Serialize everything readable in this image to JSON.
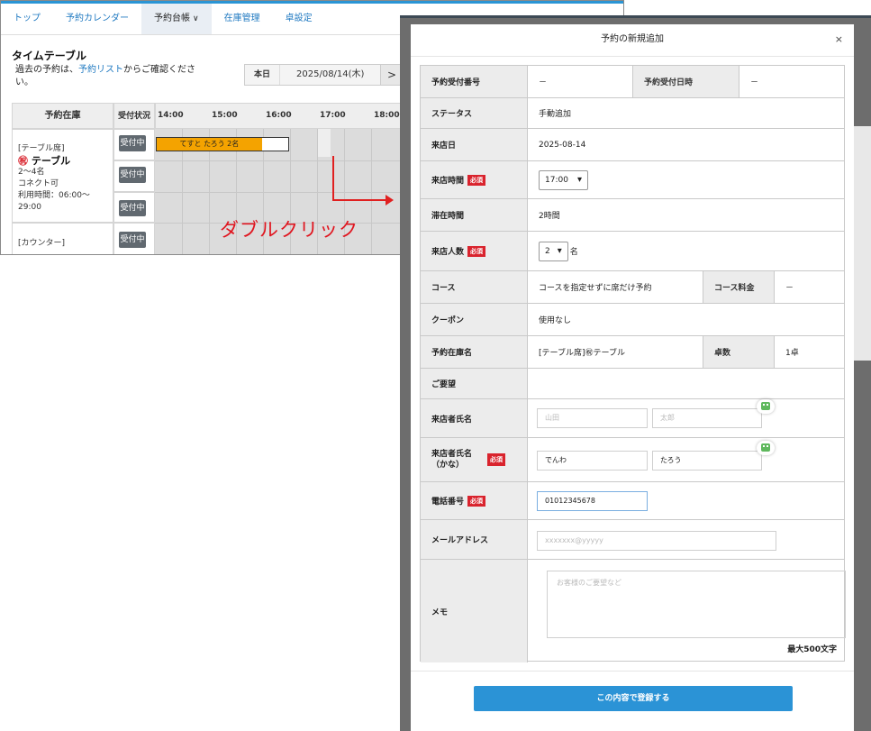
{
  "nav": {
    "items": [
      "トップ",
      "予約カレンダー",
      "予約台帳",
      "在庫管理",
      "卓設定"
    ],
    "active_index": 2
  },
  "timetable": {
    "title": "タイムテーブル",
    "note_prefix": "過去の予約は、",
    "note_link": "予約リスト",
    "note_suffix": "からご確認ください。",
    "today_label": "本日",
    "date": "2025/08/14(木)",
    "next_label": ">",
    "headers": {
      "inventory": "予約在庫",
      "status": "受付状況",
      "times": [
        "14:00",
        "15:00",
        "16:00",
        "17:00",
        "18:00"
      ]
    },
    "rows": [
      {
        "category": "[テーブル席]",
        "name": "テーブル",
        "capacity": "2〜4名",
        "connect": "コネクト可",
        "hours": "利用時間：06:00〜29:00"
      },
      {
        "category": "[カウンター]"
      }
    ],
    "status_label": "受付中",
    "booking": {
      "label": "てすと たろう 2名",
      "fill_fraction": 0.8
    }
  },
  "annotation": {
    "text": "ダブルクリック"
  },
  "modal": {
    "title": "予約の新規追加",
    "close": "×",
    "required": "必須",
    "fields": {
      "reception_no_label": "予約受付番号",
      "reception_no": "－",
      "reception_at_label": "予約受付日時",
      "reception_at": "－",
      "status_label": "ステータス",
      "status": "手動追加",
      "visit_date_label": "来店日",
      "visit_date": "2025-08-14",
      "visit_time_label": "来店時間",
      "visit_time": "17:00",
      "stay_label": "滞在時間",
      "stay": "2時間",
      "people_label": "来店人数",
      "people": "2",
      "people_unit": "名",
      "course_label": "コース",
      "course": "コースを指定せずに席だけ予約",
      "course_fee_label": "コース料金",
      "course_fee": "－",
      "coupon_label": "クーポン",
      "coupon": "使用なし",
      "inventory_label": "予約在庫名",
      "inventory": "[テーブル席]㊗テーブル",
      "tables_label": "卓数",
      "tables": "1卓",
      "request_label": "ご要望",
      "name_label": "来店者氏名",
      "last_name_ph": "山田",
      "first_name_ph": "太郎",
      "kana_label": "来店者氏名（かな）",
      "kana_last": "でんわ",
      "kana_first": "たろう",
      "phone_label": "電話番号",
      "phone": "01012345678",
      "email_label": "メールアドレス",
      "email_ph": "xxxxxxx@yyyyy",
      "memo_label": "メモ",
      "memo_ph": "お客様のご要望など",
      "memo_max": "最大500文字"
    },
    "submit": "この内容で登録する"
  }
}
